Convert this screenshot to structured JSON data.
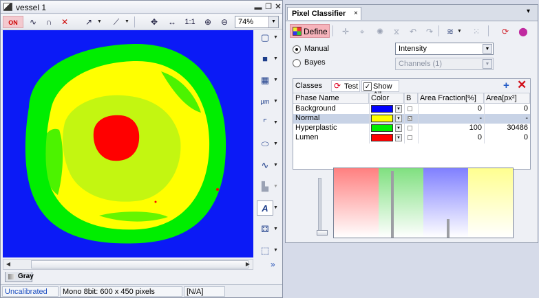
{
  "image_window": {
    "title": "vessel 1",
    "title_buttons": [
      "minimize-icon",
      "restore-icon",
      "close-icon"
    ],
    "toolbar": {
      "tools": [
        "on-toggle-icon",
        "curve-icon",
        "curve2-icon",
        "clear-icon",
        "arrow-icon",
        "contrast-curve-icon",
        "fit-icon",
        "width-icon",
        "actual-size-icon",
        "zoom-in-icon",
        "zoom-out-icon"
      ],
      "actual_size_label": "1:1",
      "zoom": "74%"
    },
    "image_colors": {
      "background": "#0b1af6",
      "normal": "#ffff00",
      "hyperplastic": "#00ee00",
      "lumen": "#ff0000"
    },
    "side_tools": [
      "rectangle-icon",
      "filled-rect-icon",
      "grid-icon",
      "measure-icon",
      "crop-icon",
      "ellipse-icon",
      "wave-icon",
      "stamp-icon",
      "text-tool-icon",
      "dots-icon",
      "region-icon"
    ],
    "measure_label": "µm",
    "channel_tab": "Gray",
    "more": "»",
    "status": {
      "calibration": "Uncalibrated",
      "info": "Mono 8bit: 600 x 450 pixels",
      "value": "[N/A]"
    }
  },
  "pixel_classifier": {
    "tab_title": "Pixel Classifier",
    "tab_close": "×",
    "menu_icon": "▾",
    "define_label": "Define",
    "toolbar_icons": [
      "plus-cross-icon",
      "target-icon",
      "sun-icon",
      "funnel-icon",
      "undo-icon",
      "redo-icon",
      "waves-icon",
      "dots-grid-icon",
      "refresh-red-icon",
      "color-mix-icon"
    ],
    "mode": {
      "manual_label": "Manual",
      "bayes_label": "Bayes",
      "selected": "Manual",
      "feature": "Intensity",
      "channels": "Channels (1)"
    },
    "classes": {
      "label": "Classes",
      "test_label": "Test",
      "show_all_label": "Show All",
      "show_all_checked": true,
      "columns": [
        "Phase Name",
        "Color",
        "B",
        "Area Fraction[%]",
        "Area[px²]"
      ],
      "rows": [
        {
          "name": "Background",
          "color": "#0000ff",
          "b": "",
          "fraction": "0",
          "area": "0"
        },
        {
          "name": "Normal",
          "color": "#ffff00",
          "b": "☑",
          "fraction": "-",
          "area": "-"
        },
        {
          "name": "Hyperplastic",
          "color": "#00ee00",
          "b": "",
          "fraction": "100",
          "area": "30486"
        },
        {
          "name": "Lumen",
          "color": "#ff0000",
          "b": "",
          "fraction": "0",
          "area": "0"
        }
      ]
    },
    "histogram": {
      "band_colors": [
        "#ff8080",
        "#80e080",
        "#8080ff",
        "#ffff90"
      ],
      "peaks": [
        {
          "pos": 0.32,
          "h": 0.97
        },
        {
          "pos": 0.63,
          "h": 0.27
        }
      ]
    }
  }
}
